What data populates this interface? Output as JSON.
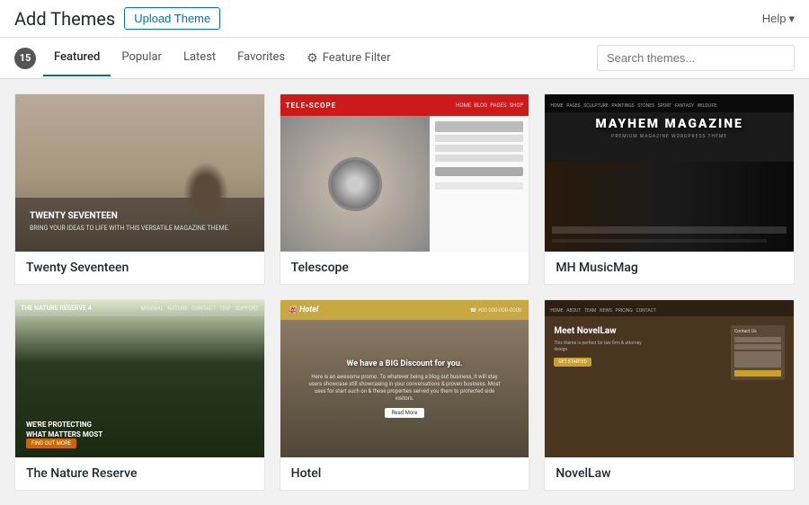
{
  "header": {
    "title": "Add Themes",
    "upload_button": "Upload Theme",
    "help_button": "Help"
  },
  "filter_bar": {
    "count": "15",
    "tabs": [
      {
        "id": "featured",
        "label": "Featured",
        "active": true
      },
      {
        "id": "popular",
        "label": "Popular",
        "active": false
      },
      {
        "id": "latest",
        "label": "Latest",
        "active": false
      },
      {
        "id": "favorites",
        "label": "Favorites",
        "active": false
      }
    ],
    "feature_filter": "Feature Filter",
    "search_placeholder": "Search themes..."
  },
  "themes": [
    {
      "id": "twenty-seventeen",
      "name": "Twenty Seventeen",
      "type": "twenty-seventeen"
    },
    {
      "id": "telescope",
      "name": "Telescope",
      "type": "telescope"
    },
    {
      "id": "mh-musicmag",
      "name": "MH MusicMag",
      "type": "mayhem"
    },
    {
      "id": "nature-reserve",
      "name": "The Nature Reserve",
      "type": "nature"
    },
    {
      "id": "hotel",
      "name": "Hotel",
      "type": "hotel"
    },
    {
      "id": "novellaw",
      "name": "NovelLaw",
      "type": "novellaw"
    }
  ]
}
